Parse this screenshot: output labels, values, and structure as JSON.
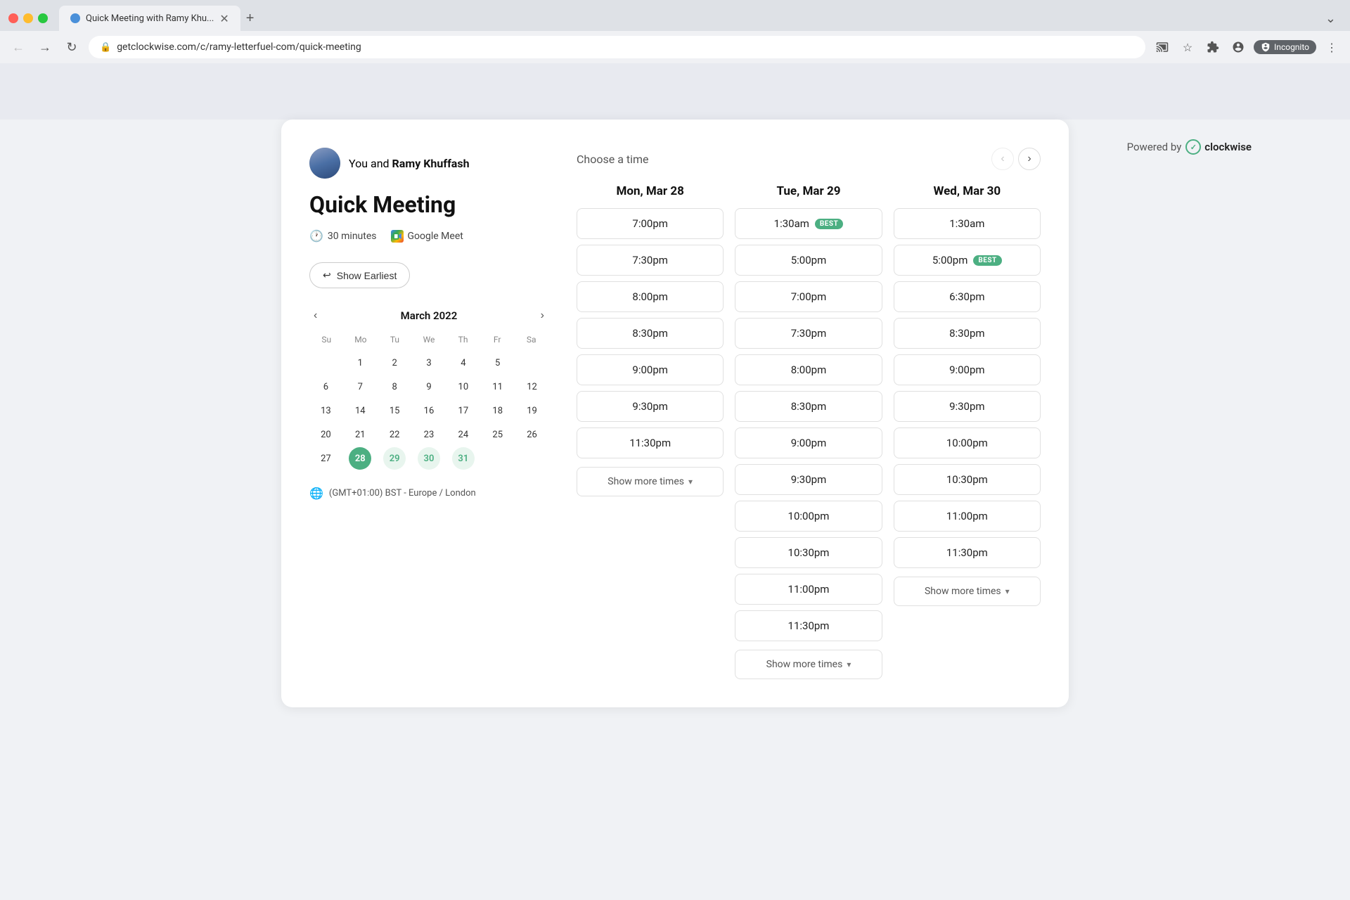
{
  "browser": {
    "tab_title": "Quick Meeting with Ramy Khu...",
    "url": "getclockwise.com/c/ramy-letterfuel-com/quick-meeting",
    "incognito_label": "Incognito",
    "new_tab_label": "+"
  },
  "powered_by": {
    "prefix": "Powered by",
    "brand": "clockwise"
  },
  "left": {
    "user_text": "You and",
    "user_name": "Ramy Khuffash",
    "meeting_title": "Quick Meeting",
    "duration": "30 minutes",
    "meet_label": "Google Meet",
    "show_earliest": "Show Earliest",
    "calendar_title": "March 2022",
    "days": [
      "Su",
      "Mo",
      "Tu",
      "We",
      "Th",
      "Fr",
      "Sa"
    ],
    "weeks": [
      [
        "",
        "1",
        "2",
        "3",
        "4",
        "5",
        ""
      ],
      [
        "6",
        "7",
        "8",
        "9",
        "10",
        "11",
        "12"
      ],
      [
        "13",
        "14",
        "15",
        "16",
        "17",
        "18",
        "19"
      ],
      [
        "20",
        "21",
        "22",
        "23",
        "24",
        "25",
        "26"
      ],
      [
        "27",
        "28",
        "29",
        "30",
        "31",
        "",
        ""
      ]
    ],
    "selected_days": [
      "28",
      "29",
      "30",
      "31"
    ],
    "today": "28",
    "timezone": "(GMT+01:00) BST - Europe / London"
  },
  "right": {
    "choose_time_label": "Choose a time",
    "days": [
      {
        "label": "Mon, Mar 28",
        "slots": [
          "7:00pm",
          "7:30pm",
          "8:00pm",
          "8:30pm",
          "9:00pm",
          "9:30pm",
          "11:30pm"
        ],
        "best_slots": [],
        "show_more": "Show more times"
      },
      {
        "label": "Tue, Mar 29",
        "slots": [
          "1:30am",
          "5:00pm",
          "7:00pm",
          "7:30pm",
          "8:00pm",
          "8:30pm",
          "9:00pm",
          "9:30pm",
          "10:00pm",
          "10:30pm",
          "11:00pm",
          "11:30pm"
        ],
        "best_slots": [
          "1:30am"
        ],
        "show_more": "Show more times"
      },
      {
        "label": "Wed, Mar 30",
        "slots": [
          "1:30am",
          "5:00pm",
          "6:30pm",
          "8:30pm",
          "9:00pm",
          "9:30pm",
          "10:00pm",
          "10:30pm",
          "11:00pm",
          "11:30pm"
        ],
        "best_slots": [
          "5:00pm"
        ],
        "show_more": "Show more times"
      }
    ]
  }
}
